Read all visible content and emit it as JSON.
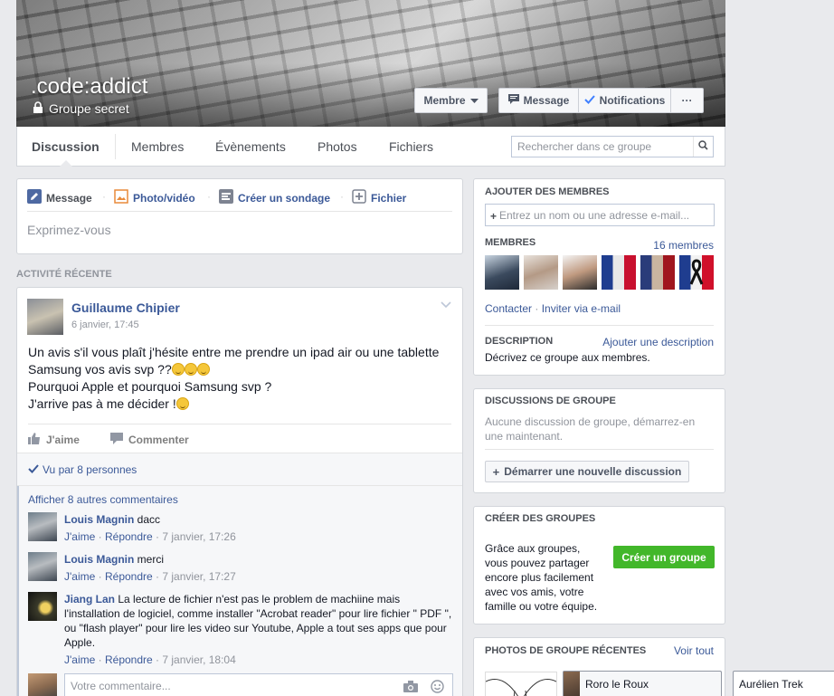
{
  "group": {
    "name": ".code:addict",
    "type": "Groupe secret"
  },
  "header_buttons": {
    "member": "Membre",
    "message": "Message",
    "notifications": "Notifications",
    "more": "···"
  },
  "tabs": [
    {
      "label": "Discussion",
      "active": true
    },
    {
      "label": "Membres"
    },
    {
      "label": "Évènements"
    },
    {
      "label": "Photos"
    },
    {
      "label": "Fichiers"
    }
  ],
  "search": {
    "placeholder": "Rechercher dans ce groupe"
  },
  "composer": {
    "tabs": [
      {
        "label": "Message",
        "icon": "pencil-icon"
      },
      {
        "label": "Photo/vidéo",
        "icon": "photo-icon"
      },
      {
        "label": "Créer un sondage",
        "icon": "poll-icon"
      },
      {
        "label": "Fichier",
        "icon": "file-icon"
      }
    ],
    "placeholder": "Exprimez-vous"
  },
  "recent_activity_title": "ACTIVITÉ RÉCENTE",
  "post": {
    "author": "Guillaume Chipier",
    "time": "6 janvier, 17:45",
    "lines": [
      "Un avis s'il vous plaît j'hésite entre me prendre un ipad air ou une tablette",
      "Samsung vos avis svp ??",
      "Pourquoi Apple et pourquoi Samsung svp ?",
      "J'arrive pas à me décider !"
    ],
    "like": "J'aime",
    "comment": "Commenter",
    "seen_by": "Vu par 8 personnes",
    "more_comments": "Afficher 8 autres commentaires",
    "comments": [
      {
        "author": "Louis Magnin",
        "text": "dacc",
        "like": "J'aime",
        "reply": "Répondre",
        "time": "7 janvier, 17:26"
      },
      {
        "author": "Louis Magnin",
        "text": "merci",
        "like": "J'aime",
        "reply": "Répondre",
        "time": "7 janvier, 17:27"
      },
      {
        "author": "Jiang Lan",
        "text": "La lecture de fichier n'est pas le problem de machiine mais l'installation de logiciel, comme installer \"Acrobat reader\" pour lire fichier \" PDF \", ou \"flash player\" pour lire les video sur Youtube, Apple a tout ses apps que pour Apple.",
        "like": "J'aime",
        "reply": "Répondre",
        "time": "7 janvier, 18:04"
      }
    ],
    "reply_placeholder": "Votre commentaire..."
  },
  "add_members": {
    "title": "AJOUTER DES MEMBRES",
    "placeholder": "Entrez un nom ou une adresse e-mail...",
    "members_title": "MEMBRES",
    "members_count": "16 membres",
    "contact": "Contacter",
    "invite": "Inviter via e-mail",
    "description_title": "DESCRIPTION",
    "add_description": "Ajouter une description",
    "description_text": "Décrivez ce groupe aux membres."
  },
  "group_discussions": {
    "title": "DISCUSSIONS DE GROUPE",
    "empty": "Aucune discussion de groupe, démarrez-en une maintenant.",
    "start_button": "Démarrer une nouvelle discussion"
  },
  "create_groups": {
    "title": "CRÉER DES GROUPES",
    "text": "Grâce aux groupes, vous pouvez partager encore plus facilement avec vos amis, votre famille ou votre équipe.",
    "button": "Créer un groupe"
  },
  "recent_photos": {
    "title": "PHOTOS DE GROUPE RÉCENTES",
    "see_all": "Voir tout"
  },
  "chat": {
    "tabs": [
      "Roro le Roux",
      "Aurélien Trek"
    ]
  },
  "colors": {
    "link": "#3b5998",
    "green_button": "#42b72a",
    "background": "#e9eaed"
  }
}
